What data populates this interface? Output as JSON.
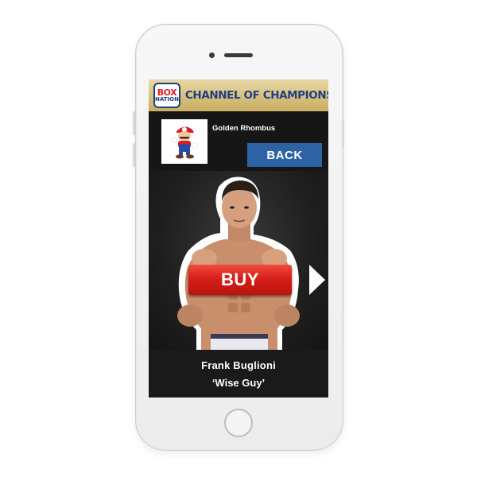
{
  "banner": {
    "logo_top": "BOX",
    "logo_bottom": "NATION",
    "title": "CHANNEL OF CHAMPIONS"
  },
  "account": {
    "username": "Golden Rhombus",
    "avatar_icon": "mario-avatar-icon"
  },
  "actions": {
    "back_label": "BACK",
    "buy_label": "BUY",
    "next_icon": "next-arrow-icon"
  },
  "fighter": {
    "name": "Frank Buglioni",
    "nickname": "‘Wise Guy’"
  },
  "colors": {
    "banner_gold": "#d8c27e",
    "brand_blue": "#1d3f86",
    "back_button": "#2d63a4",
    "buy_button": "#d81f1a",
    "screen_bg": "#161616"
  }
}
